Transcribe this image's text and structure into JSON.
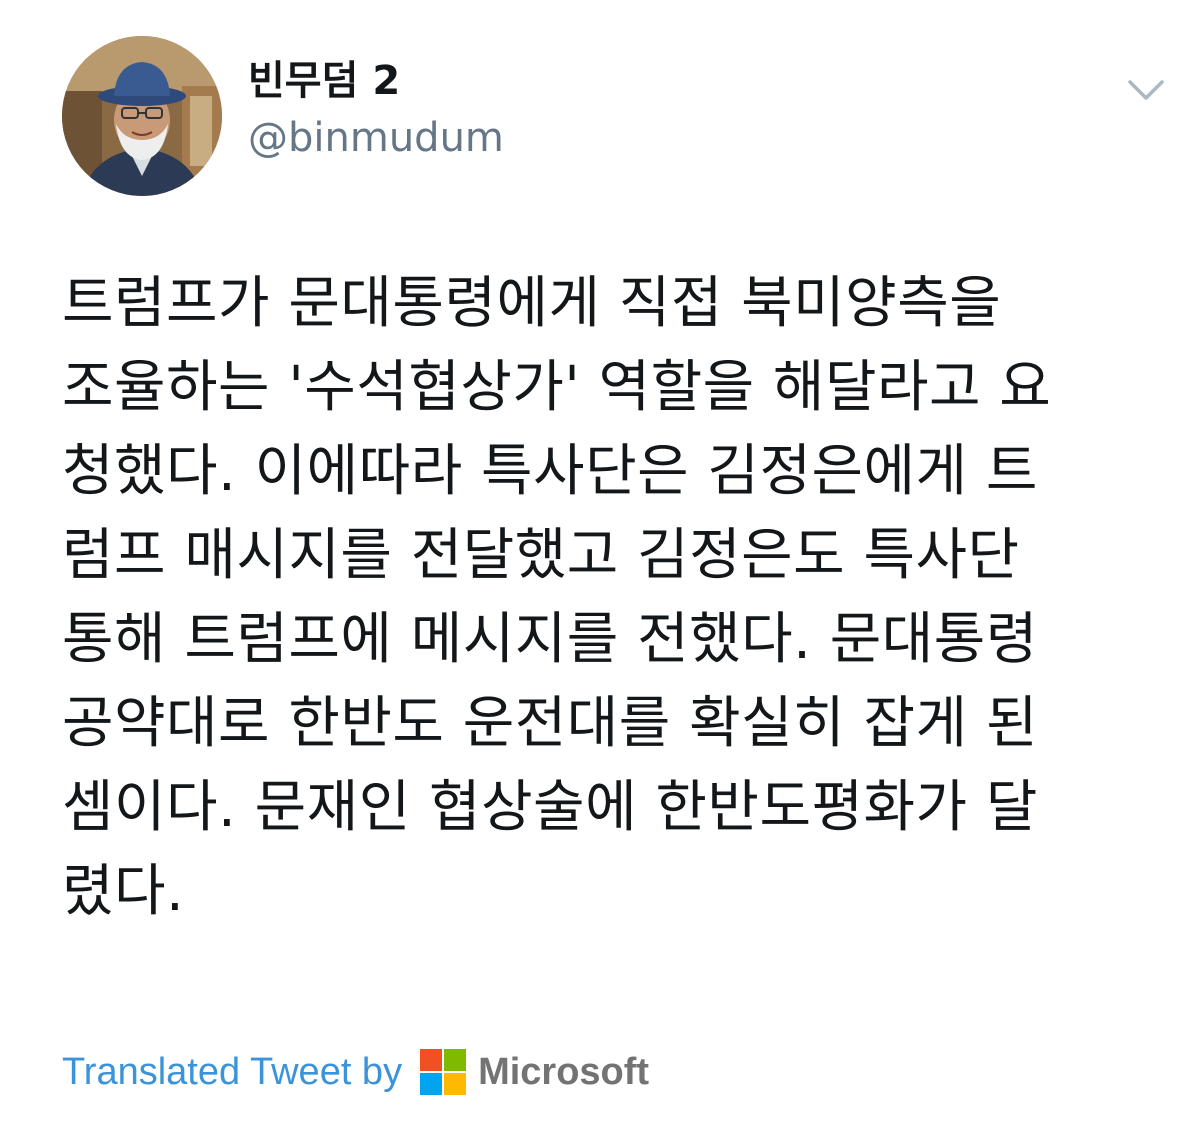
{
  "user": {
    "display_name": "빈무덤 2",
    "handle": "@binmudum",
    "avatar_icon": "profile-photo"
  },
  "menu": {
    "icon": "chevron-down-icon"
  },
  "tweet": {
    "lines": [
      "트럼프가 문대통령에게 직접 북미양측을",
      "조율하는 '수석협상가' 역할을 해달라고 요",
      "청했다. 이에따라 특사단은 김정은에게 트",
      "럼프 매시지를 전달했고 김정은도 특사단",
      "통해 트럼프에 메시지를 전했다. 문대통령",
      "공약대로 한반도 운전대를 확실히 잡게 된",
      "셈이다. 문재인 협상술에 한반도평화가 달",
      "렸다."
    ]
  },
  "translation": {
    "label": "Translated Tweet by",
    "provider": "Microsoft",
    "link_color": "#3b94d9"
  },
  "colors": {
    "text": "#14171a",
    "secondary": "#657786",
    "ms_red": "#f25022",
    "ms_green": "#7fba00",
    "ms_blue": "#00a4ef",
    "ms_yellow": "#ffb900"
  }
}
